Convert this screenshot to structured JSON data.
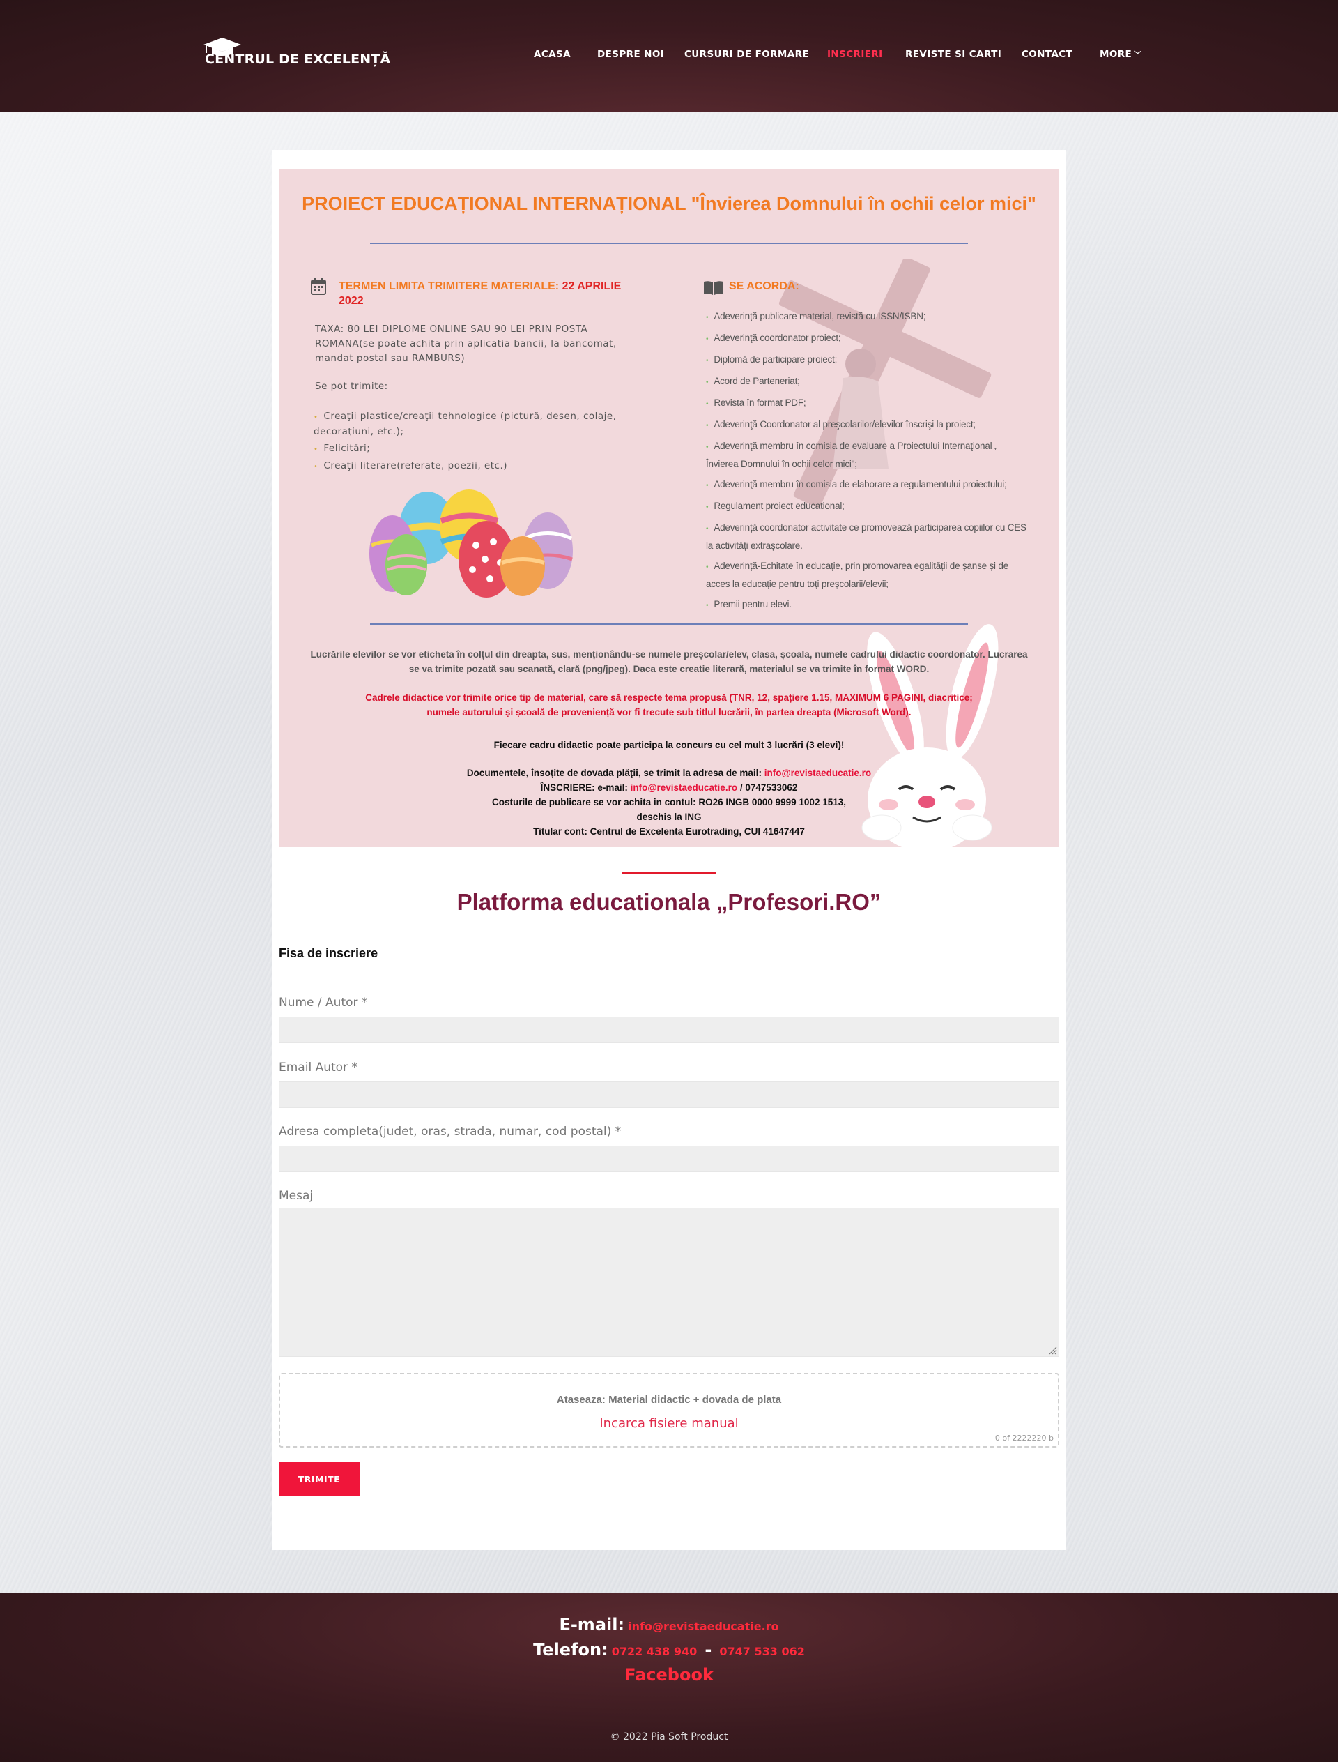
{
  "header": {
    "logo_text": "CENTRUL DE EXCELENȚĂ",
    "nav": [
      {
        "label": "ACASA"
      },
      {
        "label": "DESPRE NOI"
      },
      {
        "label": "CURSURI DE FORMARE"
      },
      {
        "label": "INSCRIERI",
        "active": true
      },
      {
        "label": "REVISTE SI CARTI"
      },
      {
        "label": "CONTACT"
      },
      {
        "label": "MORE"
      }
    ],
    "more_chevron": "﹀"
  },
  "poster": {
    "title": "PROIECT EDUCAȚIONAL INTERNAȚIONAL \"Învierea Domnului în ochii celor mici\"",
    "deadline_label": "TERMEN LIMITA TRIMITERE MATERIALE:",
    "deadline_date": "22 APRILIE 2022",
    "fee": "TAXA: 80 LEI DIPLOME ONLINE SAU 90 LEI PRIN POSTA ROMANA(se poate achita prin aplicatia bancii, la bancomat, mandat postal sau RAMBURS)",
    "can_send_title": "Se pot trimite:",
    "can_send": [
      "Creaţii plastice/creaţii tehnologice (pictură, desen, colaje, decoraţiuni, etc.);",
      "Felicitări;",
      "Creaţii literare(referate, poezii, etc.)"
    ],
    "awards_title": "SE ACORDA:",
    "awards": [
      "Adeverință publicare material, revistă cu ISSN/ISBN;",
      "Adeverinţă coordonator proiect;",
      "Diplomă de participare proiect;",
      "Acord de Parteneriat;",
      "Revista în format PDF;",
      "Adeverinţă Coordonator al preşcolarilor/elevilor înscrişi la proiect;",
      "Adeverinţă membru în comisia de evaluare a Proiectului Internaţional „ Învierea Domnului în ochii celor mici\";",
      "Adeverinţă membru în comisia de elaborare a regulamentului proiectului;",
      "Regulament proiect educational;",
      "Adeverință coordonator activitate ce promovează participarea copiilor cu CES la activități extrașcolare.",
      "Adeverință-Echitate în educație, prin promovarea egalității de șanse și de acces la educație pentru toți preșcolarii/elevii;",
      "Premii pentru elevi."
    ],
    "para1": "Lucrările elevilor se vor eticheta în colțul din dreapta, sus, menționându-se numele preșcolar/elev, clasa, școala, numele cadrului didactic coordonator. Lucrarea se va trimite pozată sau scanată, clară (png/jpeg). Daca este creatie literară, materialul se va trimite în format WORD.",
    "para2": "Cadrele didactice vor trimite orice tip de material, care să respecte tema propusă (TNR, 12, spațiere 1.15, MAXIMUM 6 PAGINI, diacritice; numele autorului și școală de proveniență vor fi trecute sub titlul lucrării, în partea dreapta (Microsoft Word).",
    "para3": "Fiecare cadru didactic poate participa la concurs cu cel mult 3 lucrări (3 elevi)!",
    "docs_label": "Documentele, însoțite de dovada plăţii, se trimit la adresa de mail:",
    "docs_email": "info@revistaeducatie.ro",
    "inscriere_label": "ÎNSCRIERE: e-mail:",
    "inscriere_email": "info@revistaeducatie.ro",
    "inscriere_phone": "/ 0747533062",
    "cost_line1": "Costurile de publicare se vor achita in contul: RO26 INGB 0000 9999 1002 1513,",
    "cost_line2": "deschis la ING",
    "holder": "Titular cont: Centrul de Excelenta Eurotrading, CUI 41647447"
  },
  "form": {
    "platform_title": "Platforma educationala „Profesori.RO”",
    "heading": "Fisa de inscriere",
    "name_label": "Nume / Autor *",
    "name_value": "",
    "email_label": "Email Autor *",
    "email_value": "",
    "address_label": "Adresa completa(judet, oras, strada, numar, cod postal) *",
    "address_value": "",
    "message_label": "Mesaj",
    "message_value": "",
    "attach_title": "Ataseaza: Material didactic + dovada de plata",
    "attach_link": "Incarca fisiere manual",
    "attach_count": "0 of 2222220 b",
    "submit": "TRIMITE"
  },
  "footer": {
    "email_label": "E-mail:",
    "email": "info@revistaeducatie.ro",
    "phone_label": "Telefon:",
    "phone1": "0722 438 940",
    "separator": "-",
    "phone2": "0747 533 062",
    "facebook": "Facebook",
    "copyright": "© 2022 Pia Soft Product"
  }
}
